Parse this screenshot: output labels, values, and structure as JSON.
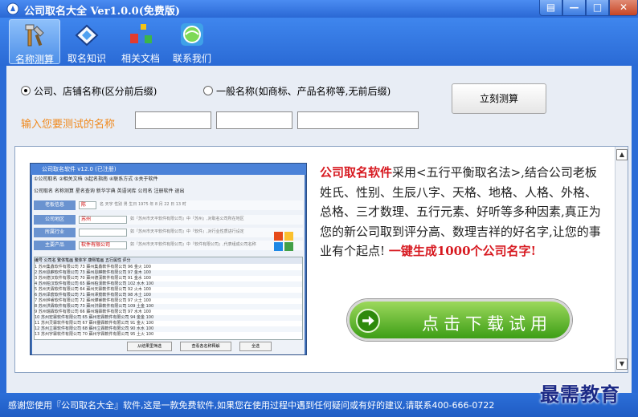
{
  "window": {
    "title": "公司取名大全 Ver1.0.0(免费版)",
    "controls": {
      "menu": "▤",
      "minimize": "—",
      "maximize": "□",
      "close": "✕"
    }
  },
  "toolbar": {
    "items": [
      {
        "label": "名称测算",
        "icon": "tools-icon"
      },
      {
        "label": "取名知识",
        "icon": "lightbulb-icon"
      },
      {
        "label": "相关文档",
        "icon": "blocks-icon"
      },
      {
        "label": "联系我们",
        "icon": "globe-icon"
      }
    ]
  },
  "form": {
    "radio_company": "公司、店铺名称(区分前后缀)",
    "radio_general": "一般名称(如商标、产品名称等,无前后缀)",
    "selected": "company",
    "test_button": "立刻测算",
    "name_label": "输入您要测试的名称",
    "inputs": [
      "",
      "",
      ""
    ]
  },
  "ad": {
    "desc_brand": "公司取名软件",
    "desc_body": "采用<五行平衡取名法>,结合公司老板姓氏、性别、生辰八字、天格、地格、人格、外格、总格、三才数理、五行元素、好听等多种因素,真正为您的新公司取到评分高、数理吉祥的好名字,让您的事业有个起点!",
    "desc_cta": "一键生成1000个公司名字!",
    "download_label": "点击下载试用",
    "mini": {
      "title": "公司取名软件 v12.0 (已注册)",
      "menu": "①公司取名  ②相关文档  ③起名指南  ④联系方式  ⑤关于软件",
      "tools": "公司取名  名称测算  星名查询  新华字典  英语词库  公司名  注册软件  退出",
      "rows": [
        {
          "tag": "老板信息",
          "value": "陈",
          "note": "名 天宇  性别 男  生日 1975 年 8 月 22 日 13 时"
        },
        {
          "tag": "公司地区",
          "value": "苏州",
          "note": "如『苏州市天平软件有限公司』中『苏州』,对取名公司所在地区"
        },
        {
          "tag": "所属行业",
          "value": "",
          "note": "如『苏州市天平软件有限公司』中『软件』,对行业性质进行设定"
        },
        {
          "tag": "主要产品",
          "value": "软件有限公司",
          "note": "如『苏州市天平软件有限公司』中『软件有限公司』,代表组成公司名称"
        }
      ],
      "table_head": "编号  公司名  繁体笔画  繁体字  康熙笔画  五行属性  评分",
      "table_rows": [
        "1  苏州集鑫软件有限公司  73  蘇州集鑫軟件有限公司  96  金火  100",
        "2  苏州恩麒软件有限公司  73  蘇州恩麒軟件有限公司  97  金木  100",
        "3  苏州德汉软件有限公司  70  蘇州德漢軟件有限公司  91  金水  100",
        "4  苏州柏汉软件有限公司  65  蘇州柏漢軟件有限公司  102  水木  100",
        "5  苏州天霖软件有限公司  64  蘇州天霖軟件有限公司  92  火木  100",
        "6  苏州泽宸软件有限公司  71  蘇州澤宸軟件有限公司  98  木土  100",
        "7  苏州烨睿软件有限公司  72  蘇州燁睿軟件有限公司  97  火土  100",
        "8  苏州洪霖软件有限公司  73  蘇州洪霖軟件有限公司  109  土金  100",
        "9  苏州瑞霖软件有限公司  66  蘇州瑞霖軟件有限公司  97  水木  100",
        "10  苏州宏霖软件有限公司  65  蘇州宏霖軟件有限公司  94  金金  100",
        "11  苏州灵霖软件有限公司  67  蘇州靈霖軟件有限公司  91  金火  100",
        "12  苏州立霖软件有限公司  68  蘇州立霖軟件有限公司  90  水水  100",
        "13  苏州宇霖软件有限公司  70  蘇州宇霖軟件有限公司  95  土火  100"
      ],
      "buttons": [
        "从结果里筛选",
        "查看各名称释解",
        "全选"
      ]
    }
  },
  "status": {
    "text": "感谢您使用『公司取名大全』软件,这是一款免费软件,如果您在使用过程中遇到任何疑问或有好的建议,请联系400-666-0722"
  },
  "watermark": "最需教育",
  "colors": {
    "titlebar": "#2a68d4",
    "accent_orange": "#f08a1e",
    "brand_red": "#d71920",
    "download_green": "#3d9e16"
  }
}
